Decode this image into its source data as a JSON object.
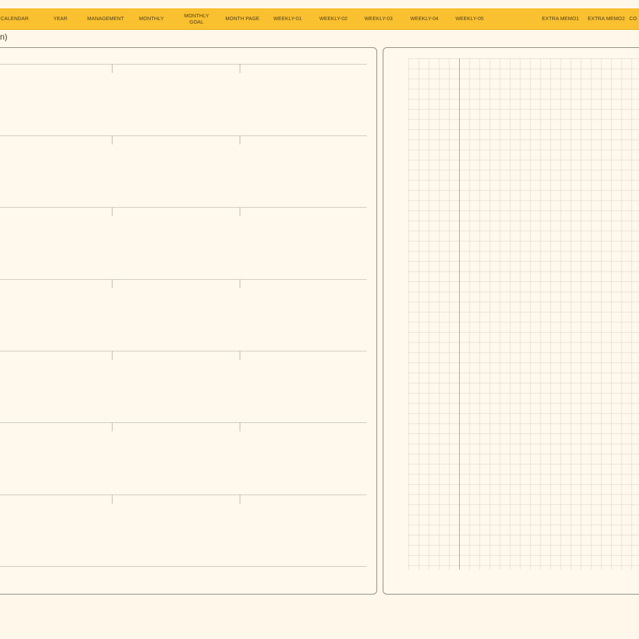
{
  "tabs": [
    {
      "id": "calendar",
      "label": "CALENDAR"
    },
    {
      "id": "year",
      "label": "YEAR"
    },
    {
      "id": "management",
      "label": "MANAGEMENT"
    },
    {
      "id": "monthly",
      "label": "MONTHLY"
    },
    {
      "id": "goal",
      "label": "MONTHLY\nGOAL"
    },
    {
      "id": "monthpage",
      "label": "MONTH PAGE"
    },
    {
      "id": "w1",
      "label": "WEEKLY-01"
    },
    {
      "id": "w2",
      "label": "WEEKLY-02"
    },
    {
      "id": "w3",
      "label": "WEEKLY-03"
    },
    {
      "id": "w4",
      "label": "WEEKLY-04"
    },
    {
      "id": "w5",
      "label": "WEEKLY-05"
    },
    {
      "id": "memo1",
      "label": "EXTRA MEMO1"
    },
    {
      "id": "memo2",
      "label": "EXTRA MEMO2"
    },
    {
      "id": "co",
      "label": "CO"
    }
  ],
  "subheader": {
    "text": "n)"
  },
  "colors": {
    "tabbar": "#f9c02f",
    "page_bg": "#fff7ea",
    "panel_border": "#8d8a84",
    "row_line": "#cfcac2"
  },
  "left_panel": {
    "row_count": 7
  }
}
